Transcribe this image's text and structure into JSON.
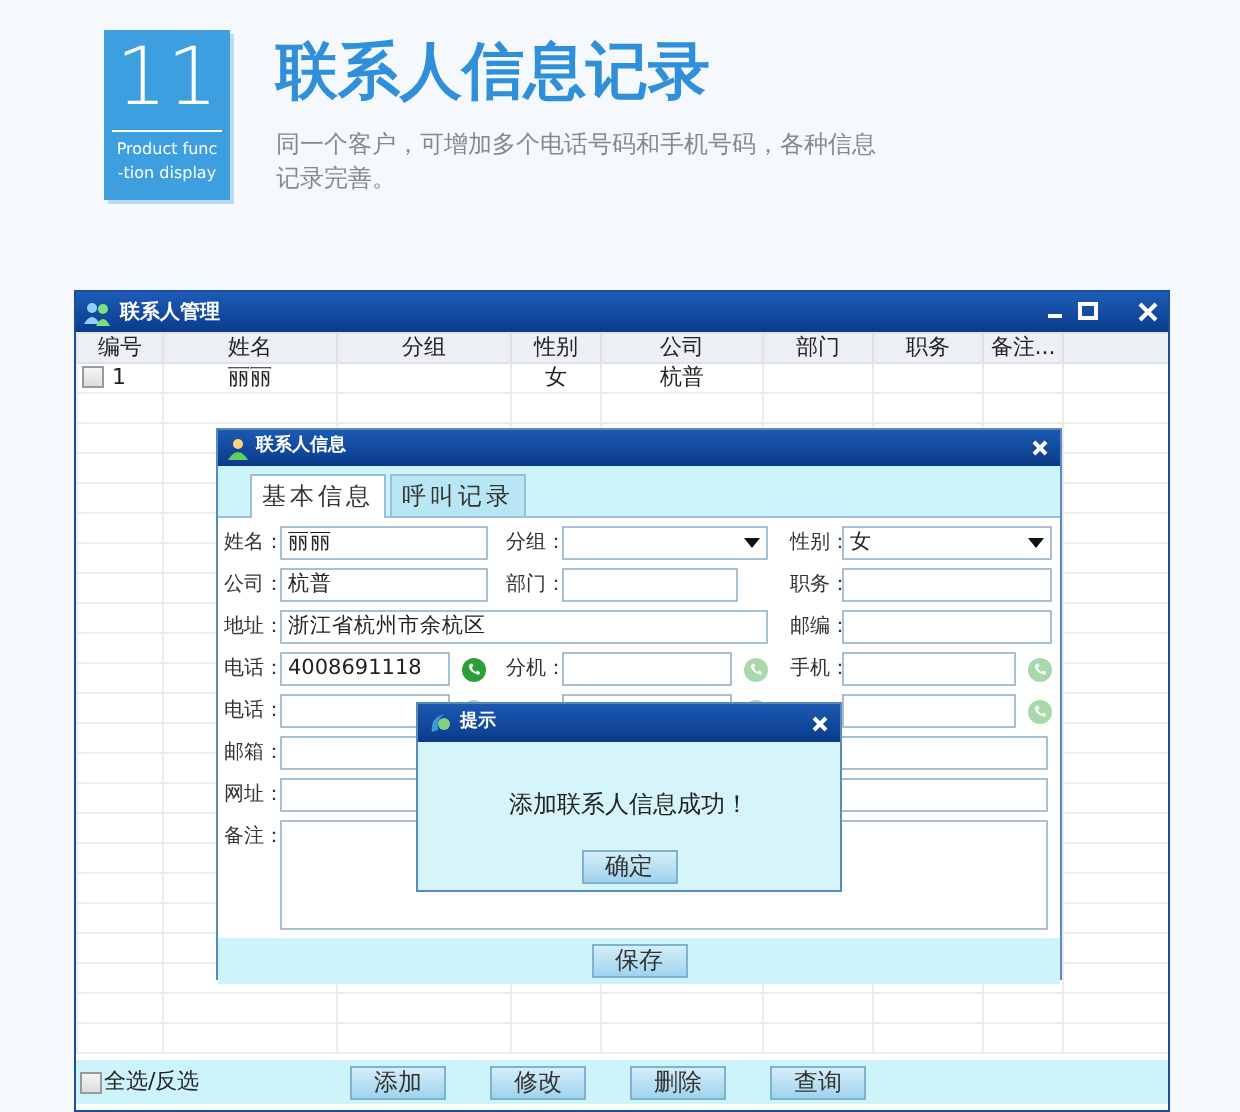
{
  "header": {
    "badge_number": "11",
    "badge_lines": [
      "Product func",
      "-tion display"
    ],
    "title": "联系人信息记录",
    "subtitle": "同一个客户，可增加多个电话号码和手机号码，各种信息记录完善。"
  },
  "main_window": {
    "title": "联系人管理",
    "table": {
      "columns": [
        "编号",
        "姓名",
        "分组",
        "性别",
        "公司",
        "部门",
        "职务",
        "备注..."
      ],
      "rows": [
        {
          "checked": false,
          "cells": [
            "1",
            "丽丽",
            null,
            "女",
            "杭普",
            null,
            null,
            null
          ]
        }
      ]
    },
    "select_all": {
      "label": "全选/反选",
      "checked": false
    },
    "buttons": [
      "添加",
      "修改",
      "删除",
      "查询"
    ]
  },
  "contact_dialog": {
    "title": "联系人信息",
    "tabs": [
      {
        "label": "基本信息",
        "selected": true
      },
      {
        "label": "呼叫记录",
        "selected": false
      }
    ],
    "rows": [
      [
        {
          "kind": "text",
          "label": "姓名：",
          "value": "丽丽"
        },
        {
          "kind": "select",
          "label": "分组："
        },
        {
          "kind": "select",
          "label": "性别：",
          "value": "女"
        }
      ],
      [
        {
          "kind": "text",
          "label": "公司：",
          "value": "杭普"
        },
        {
          "kind": "text",
          "label": "部门："
        },
        {
          "kind": "text",
          "label": "职务："
        }
      ],
      [
        {
          "kind": "wide",
          "label": "地址：",
          "value": "浙江省杭州市余杭区"
        },
        null,
        {
          "kind": "text",
          "label": "邮编："
        }
      ],
      [
        {
          "kind": "phone",
          "label": "电话：",
          "value": "4008691118",
          "call_active": true
        },
        {
          "kind": "phone",
          "label": "分机：",
          "call_active": false
        },
        {
          "kind": "phone",
          "label": "手机：",
          "call_active": false
        }
      ],
      [
        {
          "kind": "phone",
          "label": "电话：",
          "call_active": false
        },
        {
          "kind": "phone",
          "call_active": false
        },
        {
          "kind": "phone",
          "call_active": false
        }
      ],
      [
        {
          "kind": "full",
          "label": "邮箱："
        }
      ],
      [
        {
          "kind": "full",
          "label": "网址："
        }
      ],
      [
        {
          "kind": "textarea",
          "label": "备注："
        }
      ]
    ],
    "save_button": "保存"
  },
  "alert": {
    "title": "提示",
    "message": "添加联系人信息成功！",
    "ok_button": "确定"
  }
}
